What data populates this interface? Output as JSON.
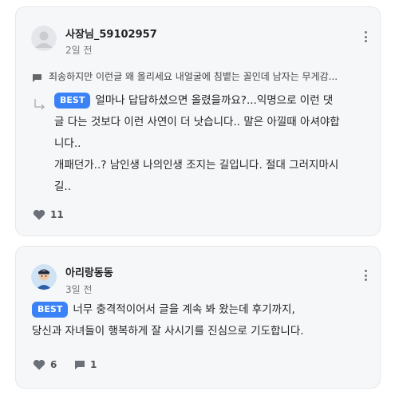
{
  "comments": [
    {
      "author": "사장님_59102957",
      "time": "2일 전",
      "quote": "죄송하지만 이런글 왜 올리세요 내얼굴에 침뱉는 꼴인데 남자는 무게감...",
      "badge": "BEST",
      "body_lines": [
        "얼마나 답답하셨으면 올렸을까요?...익명으로 이런 댓",
        "글 다는 것보다 이런 사연이 더 낫습니다.. 말은 아낄때 아셔야합",
        "니다..",
        "개패던가..? 남인생 나의인생 조지는 길입니다. 절대 그러지마시",
        "길.."
      ],
      "likes": "11"
    },
    {
      "author": "아리랑동동",
      "time": "3일 전",
      "badge": "BEST",
      "body_lines": [
        "너무 충격적이어서 글을 계속 봐 왔는데 후기까지,",
        "당신과 자녀들이 행복하게 잘 사시기를 진심으로 기도합니다."
      ],
      "likes": "6",
      "replies": "1"
    }
  ],
  "colors": {
    "accent": "#3b82f6",
    "card_bg": "#f6f7f9",
    "muted": "#777777"
  }
}
